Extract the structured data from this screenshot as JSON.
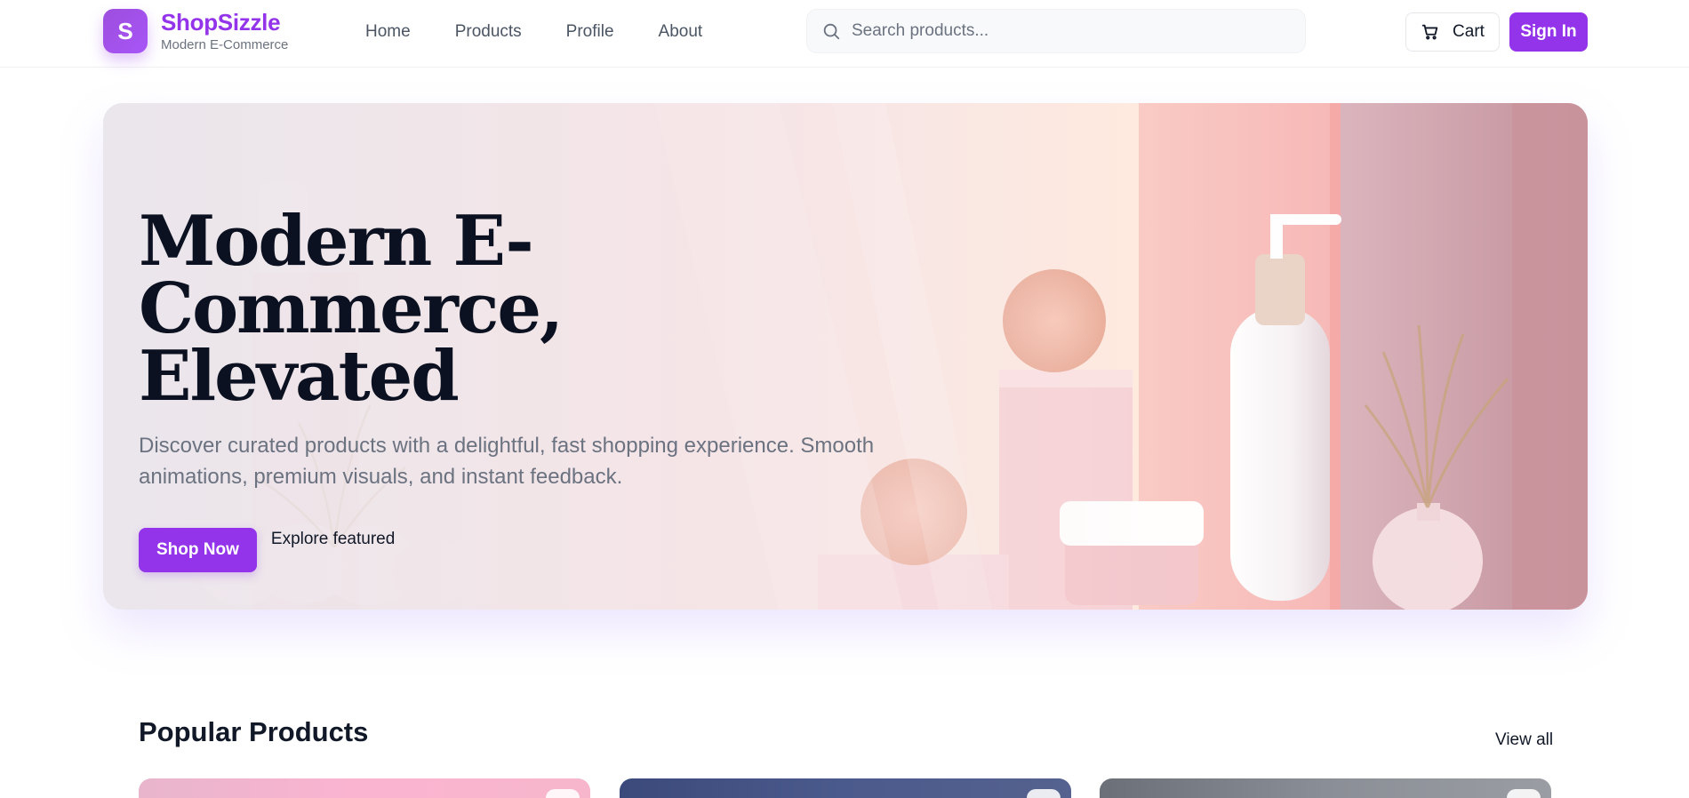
{
  "brand": {
    "name": "ShopSizzle",
    "tagline": "Modern E-Commerce",
    "logo_letter": "S"
  },
  "nav": {
    "items": [
      {
        "label": "Home"
      },
      {
        "label": "Products"
      },
      {
        "label": "Profile"
      },
      {
        "label": "About"
      }
    ]
  },
  "search": {
    "placeholder": "Search products...",
    "value": "",
    "icon": "search-icon"
  },
  "header_actions": {
    "cart_label": "Cart",
    "cart_icon": "cart-icon",
    "signin_label": "Sign In"
  },
  "hero": {
    "title_line1": "Modern E-Commerce,",
    "title_line2": "Elevated",
    "subtitle": "Discover curated products with a delightful, fast shopping experience. Smooth animations, premium visuals, and instant feedback.",
    "primary_cta": "Shop Now",
    "secondary_cta": "Explore featured"
  },
  "popular": {
    "title": "Popular Products",
    "view_all": "View all"
  },
  "colors": {
    "accent": "#9333ea",
    "text": "#111827",
    "muted": "#6b7280"
  }
}
